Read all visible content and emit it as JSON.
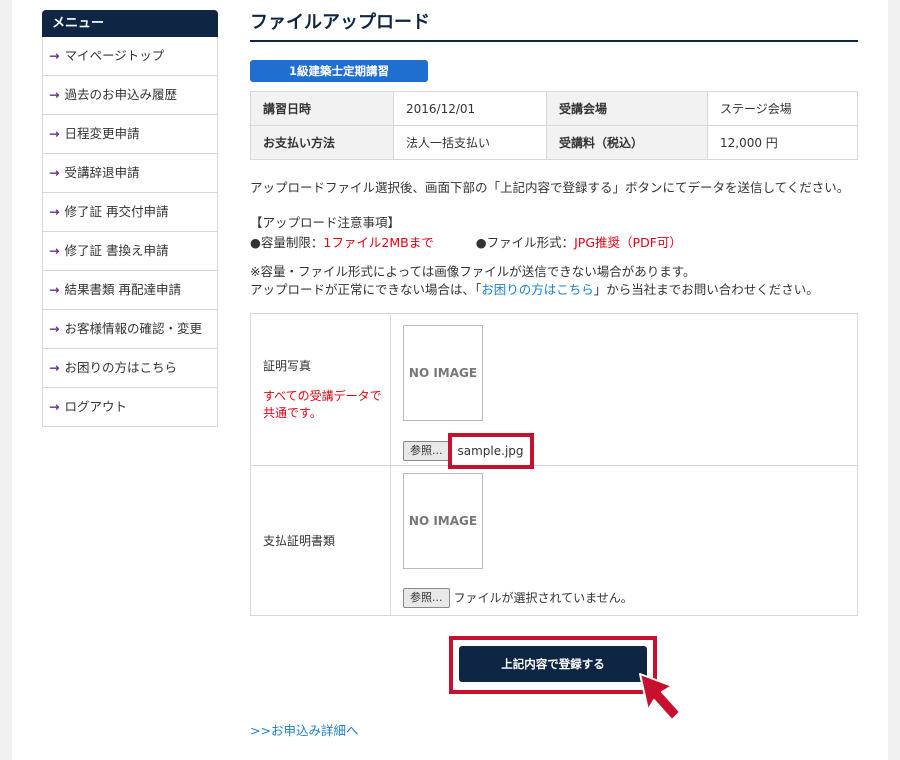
{
  "sidebar": {
    "title": "メニュー",
    "items": [
      "マイページトップ",
      "過去のお申込み履歴",
      "日程変更申請",
      "受講辞退申請",
      "修了証 再交付申請",
      "修了証 書換え申請",
      "結果書類 再配達申請",
      "お客様情報の確認・変更",
      "お困りの方はこちら",
      "ログアウト"
    ]
  },
  "main": {
    "title": "ファイルアップロード",
    "course_badge": "1級建築士定期講習",
    "info": {
      "date_label": "講習日時",
      "date_value": "2016/12/01",
      "venue_label": "受講会場",
      "venue_value": "ステージ会場",
      "payment_label": "お支払い方法",
      "payment_value": "法人一括支払い",
      "fee_label": "受講料（税込）",
      "fee_value": "12,000 円"
    },
    "instruction": "アップロードファイル選択後、画面下部の「上記内容で登録する」ボタンにてデータを送信してください。",
    "notes": {
      "head": "【アップロード注意事項】",
      "size_label": "●容量制限：",
      "size_value": "1ファイル2MBまで",
      "format_label": "●ファイル形式：",
      "format_value": "JPG推奨（PDF可）"
    },
    "warn1": "※容量・ファイル形式によっては画像ファイルが送信できない場合があります。",
    "warn2_pre": "アップロードが正常にできない場合は、「",
    "warn2_link": "お困りの方はこちら",
    "warn2_post": "」から当社までお問い合わせください。",
    "uploads": {
      "photo_label": "証明写真",
      "photo_note1": "すべての受講データで",
      "photo_note2": "共通です。",
      "no_image": "NO IMAGE",
      "browse_label": "参照...",
      "photo_file": "sample.jpg",
      "receipt_label": "支払証明書類",
      "receipt_file": "ファイルが選択されていません。"
    },
    "submit_label": "上記内容で登録する",
    "detail_link": ">>お申込み詳細へ"
  },
  "colors": {
    "navy": "#0f2544",
    "badge_blue": "#1f6fd1",
    "highlight_red": "#c8102e",
    "note_red": "#e60012",
    "link_blue": "#1a7fd1",
    "arrow_purple": "#6a2c8e"
  },
  "icons": {
    "menu_arrow": "→",
    "cursor": "pointer-arrow-icon"
  }
}
